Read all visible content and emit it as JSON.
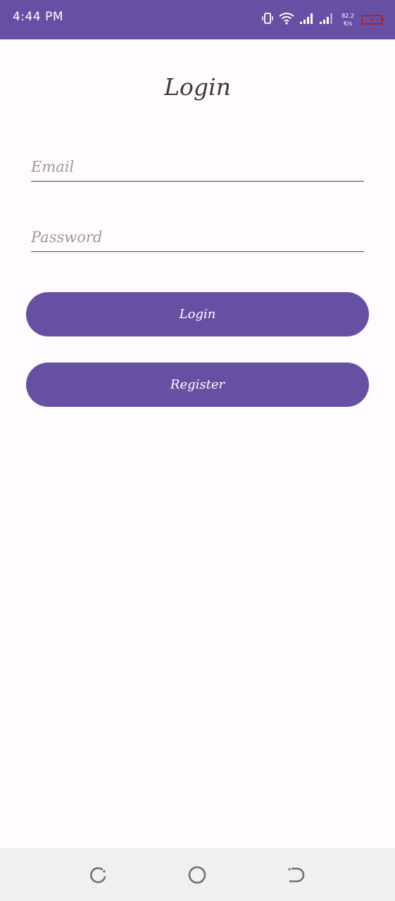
{
  "status_bar": {
    "time": "4:44 PM",
    "net_speed_value": "82.2",
    "net_speed_unit": "K/s",
    "battery_level": "9",
    "icons": [
      "vibrate-icon",
      "wifi-icon",
      "signal-icon",
      "signal-icon",
      "battery-icon"
    ]
  },
  "screen": {
    "title": "Login"
  },
  "form": {
    "email": {
      "placeholder": "Email",
      "value": ""
    },
    "password": {
      "placeholder": "Password",
      "value": ""
    },
    "login_label": "Login",
    "register_label": "Register"
  },
  "nav_bar": {
    "icons": [
      "recents-icon",
      "home-icon",
      "back-icon"
    ]
  },
  "colors": {
    "primary": "#6750a4",
    "background": "#fffbfe",
    "nav_background": "#f0f0f0",
    "battery_low": "#b3261e"
  }
}
